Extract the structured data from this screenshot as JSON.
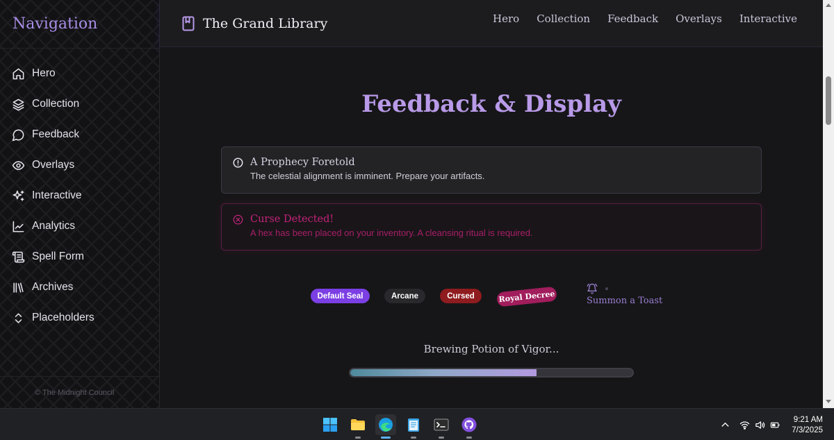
{
  "sidebar": {
    "title": "Navigation",
    "items": [
      {
        "label": "Hero",
        "icon": "home-icon"
      },
      {
        "label": "Collection",
        "icon": "layers-icon"
      },
      {
        "label": "Feedback",
        "icon": "message-icon"
      },
      {
        "label": "Overlays",
        "icon": "eye-icon"
      },
      {
        "label": "Interactive",
        "icon": "sparkles-icon"
      },
      {
        "label": "Analytics",
        "icon": "line-chart-icon"
      },
      {
        "label": "Spell Form",
        "icon": "scroll-icon"
      },
      {
        "label": "Archives",
        "icon": "library-icon"
      },
      {
        "label": "Placeholders",
        "icon": "chevrons-up-down-icon"
      }
    ],
    "footer": "© The Midnight Council"
  },
  "header": {
    "brand": "The Grand Library",
    "links": [
      "Hero",
      "Collection",
      "Feedback",
      "Overlays",
      "Interactive"
    ]
  },
  "main": {
    "title": "Feedback & Display",
    "alerts": {
      "info": {
        "title": "A Prophecy Foretold",
        "description": "The celestial alignment is imminent. Prepare your artifacts."
      },
      "error": {
        "title": "Curse Detected!",
        "description": "A hex has been placed on your inventory. A cleansing ritual is required."
      }
    },
    "badges": {
      "default": "Default Seal",
      "arcane": "Arcane",
      "cursed": "Cursed",
      "royal": "Royal Decree"
    },
    "toast_button": "Summon a Toast",
    "progress": {
      "label": "Brewing Potion of Vigor...",
      "value_percent": 66
    }
  },
  "taskbar": {
    "apps": [
      "windows-start-icon",
      "file-explorer-icon",
      "edge-browser-icon",
      "notepad-icon",
      "terminal-icon",
      "github-icon"
    ],
    "time": "9:21 AM",
    "date": "7/3/2025"
  },
  "colors": {
    "accent": "#b89ae8",
    "primary_badge": "#7b3fe4",
    "cursed": "#8f1c1f",
    "royal": "#a11d5c",
    "error_text": "#c2237a"
  }
}
